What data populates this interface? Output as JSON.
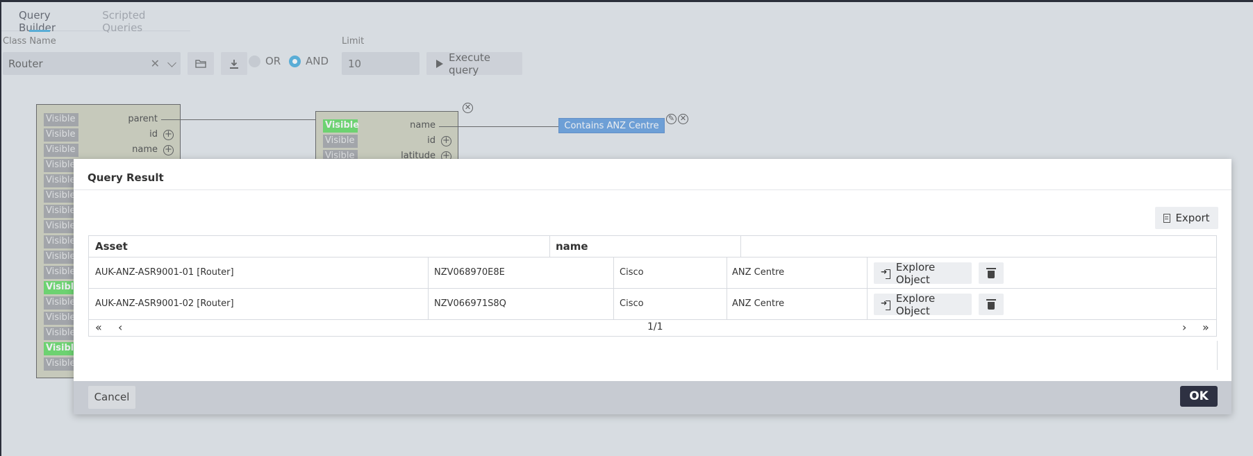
{
  "tabs": [
    {
      "label": "Query Builder",
      "active": true
    },
    {
      "label": "Scripted Queries",
      "active": false
    }
  ],
  "controls": {
    "class_name_label": "Class Name",
    "class_name_value": "Router",
    "clear_glyph": "✕",
    "operators": [
      {
        "label": "OR",
        "selected": false
      },
      {
        "label": "AND",
        "selected": true
      }
    ],
    "limit_label": "Limit",
    "limit_value": "10",
    "execute_label": "Execute query"
  },
  "diagram": {
    "node1": {
      "visible_label": "Visible",
      "props": [
        "parent",
        "id",
        "name"
      ],
      "visible_states": [
        false,
        false,
        false,
        false,
        false,
        false,
        false,
        false,
        false,
        false,
        false,
        true,
        false,
        false,
        false,
        true,
        false
      ]
    },
    "node2": {
      "visible_label": "Visible",
      "props": [
        "name",
        "id",
        "latitude"
      ],
      "visible_states": [
        true,
        false,
        false
      ]
    },
    "condition_label": "Contains ANZ Centre",
    "plus_glyph": "+",
    "close_glyph": "✕",
    "edit_glyph": "✎"
  },
  "modal": {
    "title": "Query Result",
    "export_label": "Export",
    "columns": [
      "Asset",
      "name",
      ""
    ],
    "rows": [
      {
        "asset": "AUK-ANZ-ASR9001-01 [Router]",
        "serial": "NZV068970E8E",
        "vendor": "Cisco",
        "name": "ANZ Centre",
        "explore_label": "Explore Object"
      },
      {
        "asset": "AUK-ANZ-ASR9001-02 [Router]",
        "serial": "NZV066971S8Q",
        "vendor": "Cisco",
        "name": "ANZ Centre",
        "explore_label": "Explore Object"
      }
    ],
    "pager": {
      "first": "«",
      "prev": "‹",
      "page_text": "1/1",
      "next": "›",
      "last": "»"
    },
    "cancel_label": "Cancel",
    "ok_label": "OK"
  },
  "colors": {
    "accent": "#1e9bd7",
    "visible_on": "#3cd43c",
    "condition": "#3d86d8",
    "ok": "#2e3142"
  }
}
